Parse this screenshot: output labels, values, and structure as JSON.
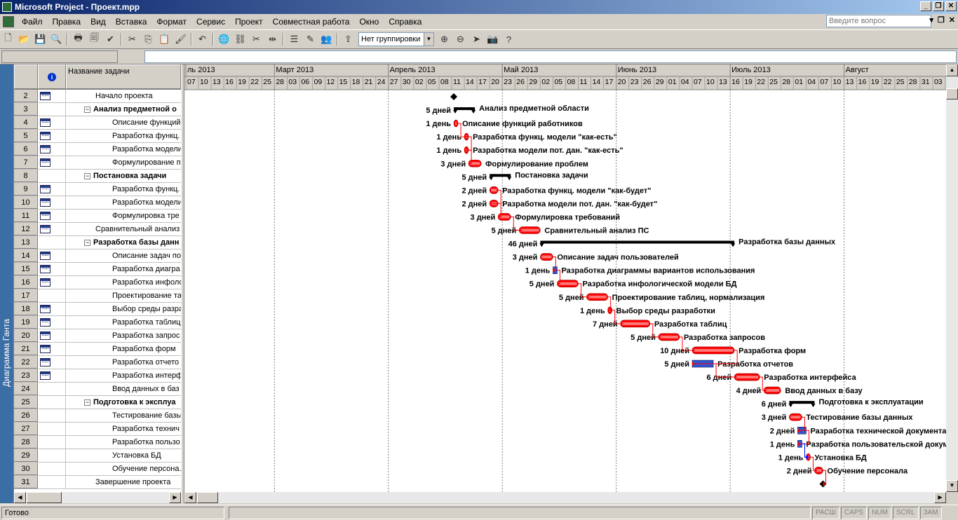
{
  "window": {
    "title": "Microsoft Project - Проект.mpp"
  },
  "menu": [
    "Файл",
    "Правка",
    "Вид",
    "Вставка",
    "Формат",
    "Сервис",
    "Проект",
    "Совместная работа",
    "Окно",
    "Справка"
  ],
  "question_placeholder": "Введите вопрос",
  "toolbar": {
    "grouping": "Нет группировки",
    "icons": [
      "new-icon",
      "open-icon",
      "save-icon",
      "search-icon",
      "print-icon",
      "print-preview-icon",
      "spelling-icon",
      "cut-icon",
      "copy-icon",
      "paste-icon",
      "format-painter-icon",
      "undo-icon",
      "hyperlink-icon",
      "link-tasks-icon",
      "unlink-tasks-icon",
      "split-task-icon",
      "task-info-icon",
      "notes-icon",
      "assign-resources-icon",
      "publish-icon",
      "zoom-in-icon",
      "zoom-out-icon",
      "goto-task-icon",
      "copy-picture-icon",
      "help-icon"
    ]
  },
  "view_bar_label": "Диаграмма Ганта",
  "table": {
    "header_name": "Название задачи",
    "rows": [
      {
        "id": "2",
        "name": "Начало проекта",
        "icon": true,
        "level": 1
      },
      {
        "id": "3",
        "name": "Анализ предметной о",
        "summary": true,
        "toggle": "−"
      },
      {
        "id": "4",
        "name": "Описание функций",
        "icon": true,
        "level": 2
      },
      {
        "id": "5",
        "name": "Разработка функц.",
        "icon": true,
        "level": 2
      },
      {
        "id": "6",
        "name": "Разработка модели",
        "icon": true,
        "level": 2
      },
      {
        "id": "7",
        "name": "Формулирование п",
        "icon": true,
        "level": 2
      },
      {
        "id": "8",
        "name": "Постановка задачи",
        "summary": true,
        "toggle": "−"
      },
      {
        "id": "9",
        "name": "Разработка функц.",
        "icon": true,
        "level": 2
      },
      {
        "id": "10",
        "name": "Разработка модели",
        "icon": true,
        "level": 2
      },
      {
        "id": "11",
        "name": "Формулировка тре",
        "icon": true,
        "level": 2
      },
      {
        "id": "12",
        "name": "Сравнительный анализ",
        "icon": true,
        "level": 1
      },
      {
        "id": "13",
        "name": "Разработка базы данн",
        "summary": true,
        "toggle": "−"
      },
      {
        "id": "14",
        "name": "Описание задач по",
        "icon": true,
        "level": 2
      },
      {
        "id": "15",
        "name": "Разработка диагра",
        "icon": true,
        "level": 2
      },
      {
        "id": "16",
        "name": "Разработка инфоло",
        "icon": true,
        "level": 2
      },
      {
        "id": "17",
        "name": "Проектирование та",
        "icon": false,
        "level": 2
      },
      {
        "id": "18",
        "name": "Выбор среды разра",
        "icon": true,
        "level": 2
      },
      {
        "id": "19",
        "name": "Разработка таблиц",
        "icon": true,
        "level": 2
      },
      {
        "id": "20",
        "name": "Разработка запрос",
        "icon": true,
        "level": 2
      },
      {
        "id": "21",
        "name": "Разработка форм",
        "icon": true,
        "level": 2
      },
      {
        "id": "22",
        "name": "Разработка отчето",
        "icon": true,
        "level": 2
      },
      {
        "id": "23",
        "name": "Разработка интерф",
        "icon": true,
        "level": 2
      },
      {
        "id": "24",
        "name": "Ввод данных в баз",
        "icon": false,
        "level": 2
      },
      {
        "id": "25",
        "name": "Подготовка к эксплуа",
        "summary": true,
        "toggle": "−"
      },
      {
        "id": "26",
        "name": "Тестирование базы",
        "level": 2
      },
      {
        "id": "27",
        "name": "Разработка технич",
        "level": 2
      },
      {
        "id": "28",
        "name": "Разработка пользо",
        "level": 2
      },
      {
        "id": "29",
        "name": "Установка БД",
        "level": 2
      },
      {
        "id": "30",
        "name": "Обучение персона.",
        "level": 2
      },
      {
        "id": "31",
        "name": "Завершение проекта",
        "level": 1
      }
    ]
  },
  "timescale": {
    "months": [
      {
        "label": "ль 2013",
        "start": 0
      },
      {
        "label": "Март 2013",
        "start": 7
      },
      {
        "label": "Апрель 2013",
        "start": 16
      },
      {
        "label": "Май 2013",
        "start": 25
      },
      {
        "label": "Июнь 2013",
        "start": 34
      },
      {
        "label": "Июль 2013",
        "start": 43
      },
      {
        "label": "Август",
        "start": 52
      }
    ],
    "days": [
      "07",
      "10",
      "13",
      "16",
      "19",
      "22",
      "25",
      "28",
      "03",
      "06",
      "09",
      "12",
      "15",
      "18",
      "21",
      "24",
      "27",
      "30",
      "02",
      "05",
      "08",
      "11",
      "14",
      "17",
      "20",
      "23",
      "26",
      "29",
      "02",
      "05",
      "08",
      "11",
      "14",
      "17",
      "20",
      "23",
      "26",
      "29",
      "01",
      "04",
      "07",
      "10",
      "13",
      "16",
      "19",
      "22",
      "25",
      "28",
      "01",
      "04",
      "07",
      "10",
      "13",
      "16",
      "19",
      "22",
      "25",
      "28",
      "31",
      "03",
      "06"
    ]
  },
  "gantt_tasks": [
    {
      "type": "milestone",
      "s": 63.5,
      "d": 0
    },
    {
      "type": "summary",
      "s": 63.5,
      "d": 5,
      "dur": "5 дней",
      "name": "Анализ предметной области"
    },
    {
      "type": "task",
      "s": 63.5,
      "d": 1,
      "dur": "1 день",
      "name": "Описание функций работников"
    },
    {
      "type": "task",
      "s": 66,
      "d": 1,
      "dur": "1 день",
      "name": "Разработка функц. модели \"как-есть\""
    },
    {
      "type": "task",
      "s": 66,
      "d": 1,
      "dur": "1 день",
      "name": "Разработка модели пот. дан. \"как-есть\""
    },
    {
      "type": "task",
      "s": 67,
      "d": 3,
      "dur": "3 дней",
      "name": "Формулирование проблем"
    },
    {
      "type": "summary",
      "s": 72,
      "d": 5,
      "dur": "5 дней",
      "name": "Постановка задачи"
    },
    {
      "type": "task",
      "s": 72,
      "d": 2,
      "dur": "2 дней",
      "name": "Разработка функц. модели \"как-будет\""
    },
    {
      "type": "task",
      "s": 72,
      "d": 2,
      "dur": "2 дней",
      "name": "Разработка модели пот. дан. \"как-будет\""
    },
    {
      "type": "task",
      "s": 74,
      "d": 3,
      "dur": "3 дней",
      "name": "Формулировка требований"
    },
    {
      "type": "task",
      "s": 79,
      "d": 5,
      "dur": "5 дней",
      "name": "Сравнительный анализ ПС"
    },
    {
      "type": "summary",
      "s": 84,
      "d": 46,
      "dur": "46 дней",
      "name": "Разработка базы данных"
    },
    {
      "type": "task",
      "s": 84,
      "d": 3,
      "dur": "3 дней",
      "name": "Описание задач пользователей"
    },
    {
      "type": "blue",
      "s": 87,
      "d": 1,
      "dur": "1 день",
      "name": "Разработка диаграммы вариантов использования"
    },
    {
      "type": "task",
      "s": 88,
      "d": 5,
      "dur": "5 дней",
      "name": "Разработка инфологической модели БД"
    },
    {
      "type": "task",
      "s": 95,
      "d": 5,
      "dur": "5 дней",
      "name": "Проектирование таблиц, нормализация"
    },
    {
      "type": "task",
      "s": 100,
      "d": 1,
      "dur": "1 день",
      "name": "Выбор среды разработки"
    },
    {
      "type": "task",
      "s": 103,
      "d": 7,
      "dur": "7 дней",
      "name": "Разработка таблиц"
    },
    {
      "type": "task",
      "s": 112,
      "d": 5,
      "dur": "5 дней",
      "name": "Разработка запросов"
    },
    {
      "type": "task",
      "s": 120,
      "d": 10,
      "dur": "10 дней",
      "name": "Разработка форм"
    },
    {
      "type": "bluebar",
      "s": 120,
      "d": 5,
      "dur": "5 дней",
      "name": "Разработка отчетов"
    },
    {
      "type": "task",
      "s": 130,
      "d": 6,
      "dur": "6 дней",
      "name": "Разработка интерфейса"
    },
    {
      "type": "task",
      "s": 137,
      "d": 4,
      "dur": "4 дней",
      "name": "Ввод данных в базу"
    },
    {
      "type": "summary",
      "s": 143,
      "d": 6,
      "dur": "6 дней",
      "name": "Подготовка к эксплуатации"
    },
    {
      "type": "task",
      "s": 143,
      "d": 3,
      "dur": "3 дней",
      "name": "Тестирование базы данных"
    },
    {
      "type": "blue",
      "s": 145,
      "d": 2,
      "dur": "2 дней",
      "name": "Разработка технической документации"
    },
    {
      "type": "blue",
      "s": 145,
      "d": 1,
      "dur": "1 день",
      "name": "Разработка пользовательской документации"
    },
    {
      "type": "task",
      "s": 147,
      "d": 1,
      "dur": "1 день",
      "name": "Установка БД"
    },
    {
      "type": "task",
      "s": 149,
      "d": 2,
      "dur": "2 дней",
      "name": "Обучение персонала"
    },
    {
      "type": "milestone",
      "s": 151,
      "d": 0
    }
  ],
  "statusbar": {
    "text": "Готово",
    "indicators": [
      "РАСШ",
      "CAPS",
      "NUM",
      "SCRL",
      "ЗАМ"
    ]
  },
  "colors": {
    "task_bar": "#ff0000",
    "link_line": "#ff0000",
    "summary_bar": "#000000",
    "title_gradient_start": "#0a246a",
    "title_gradient_end": "#a6caf0",
    "view_bar": "#3a6ea5"
  }
}
